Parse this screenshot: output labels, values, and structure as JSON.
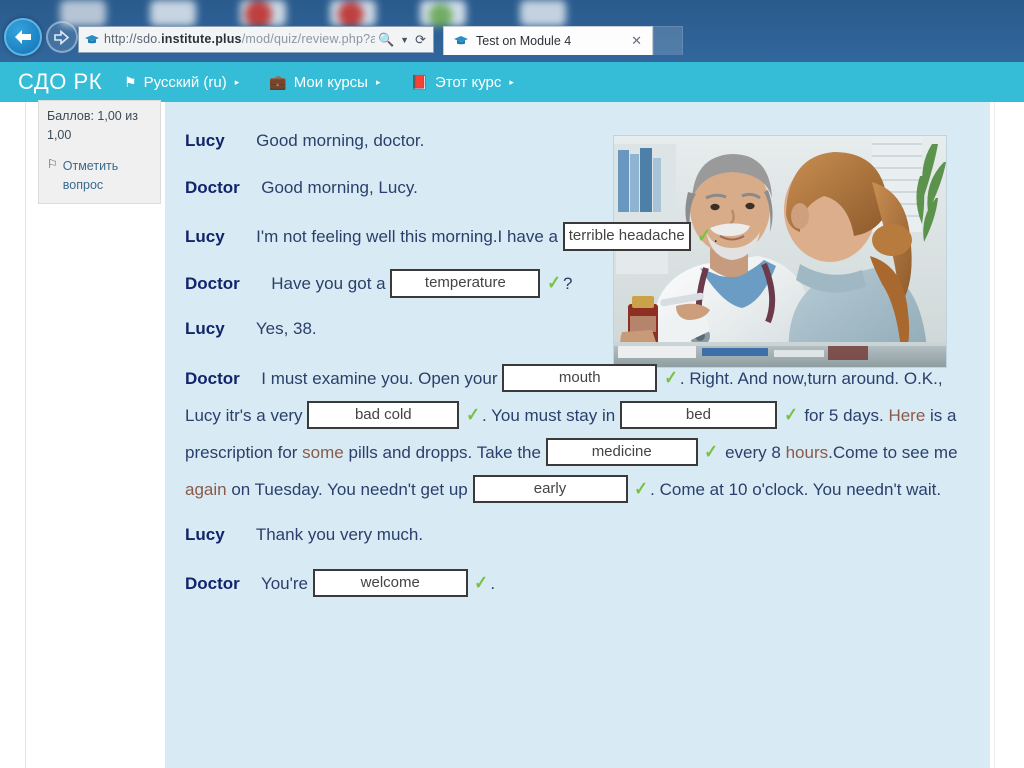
{
  "browser": {
    "back_icon": "back-arrow-icon",
    "forward_icon": "forward-arrow-icon",
    "url_prefix": "http://sdo.",
    "url_domain": "institute.plus",
    "url_path": "/mod/quiz/review.php?a",
    "search_icon": "search-icon",
    "dropdown_icon": "chevron-down-icon",
    "refresh_icon": "refresh-icon",
    "tab_title": "Test on Module 4",
    "tab_close_icon": "close-icon",
    "favicon": "graduation-cap-icon"
  },
  "navbar": {
    "brand": "СДО РК",
    "items": [
      {
        "icon": "flag-icon",
        "label": "Русский (ru)",
        "caret": "▸"
      },
      {
        "icon": "briefcase-icon",
        "label": "Мои курсы",
        "caret": "▸"
      },
      {
        "icon": "book-icon",
        "label": "Этот курс",
        "caret": "▸"
      }
    ]
  },
  "question_info": {
    "grade": "Баллов: 1,00 из 1,00",
    "flag_icon": "flag-question-icon",
    "flag_label": "Отметить вопрос"
  },
  "dialogue": {
    "speakers": {
      "lucy": "Lucy",
      "doctor": "Doctor"
    },
    "lines": [
      {
        "speaker": "Lucy",
        "text": "Good morning, doctor."
      },
      {
        "speaker": "Doctor",
        "text": "Good morning, Lucy."
      },
      {
        "speaker": "Lucy",
        "text_a": "I'm not feeling well this morning.I have a",
        "answer": "terrible headache",
        "text_b": "."
      },
      {
        "speaker": "Doctor",
        "text_a": "Have you got a",
        "answer": "temperature",
        "text_b": "?"
      },
      {
        "speaker": "Lucy",
        "text": "Yes, 38."
      },
      {
        "speaker": "Doctor",
        "t1": "I must examine you. Open your",
        "a1": "mouth",
        "t2": ". Right. And now,turn around. O.K., Lucy itr's a very",
        "a2": "bad cold",
        "t3": ". You must stay in",
        "a3": "bed",
        "t4": "for 5 days.",
        "hl1": "Here",
        "t5": "is a prescription for",
        "hl2": "some",
        "t6": "pills and dropps. Take the",
        "a4": "medicine",
        "t7": "every 8",
        "hl3": "hours",
        "t8": ".Come to see me",
        "hl4": "again",
        "t9": "on Tuesday. You needn't get up",
        "a5": "early",
        "t10": ". Come at 10 o'clock. You needn't wait."
      },
      {
        "speaker": "Lucy",
        "text": "Thank you very much."
      },
      {
        "speaker": "Doctor",
        "text_a": "You're",
        "answer": "welcome",
        "text_b": "."
      }
    ],
    "tick_mark": "✓"
  },
  "photo": {
    "alt": "doctor-patient-consultation-photo"
  },
  "colors": {
    "navbar_bg": "#35bcd6",
    "content_bg": "#d8ebf4",
    "speaker_text": "#12246b",
    "body_text": "#2a3f6b",
    "highlight_text": "#8a5a4a",
    "tick_green": "#7ac143",
    "chrome_blue": "#2d5f93"
  }
}
